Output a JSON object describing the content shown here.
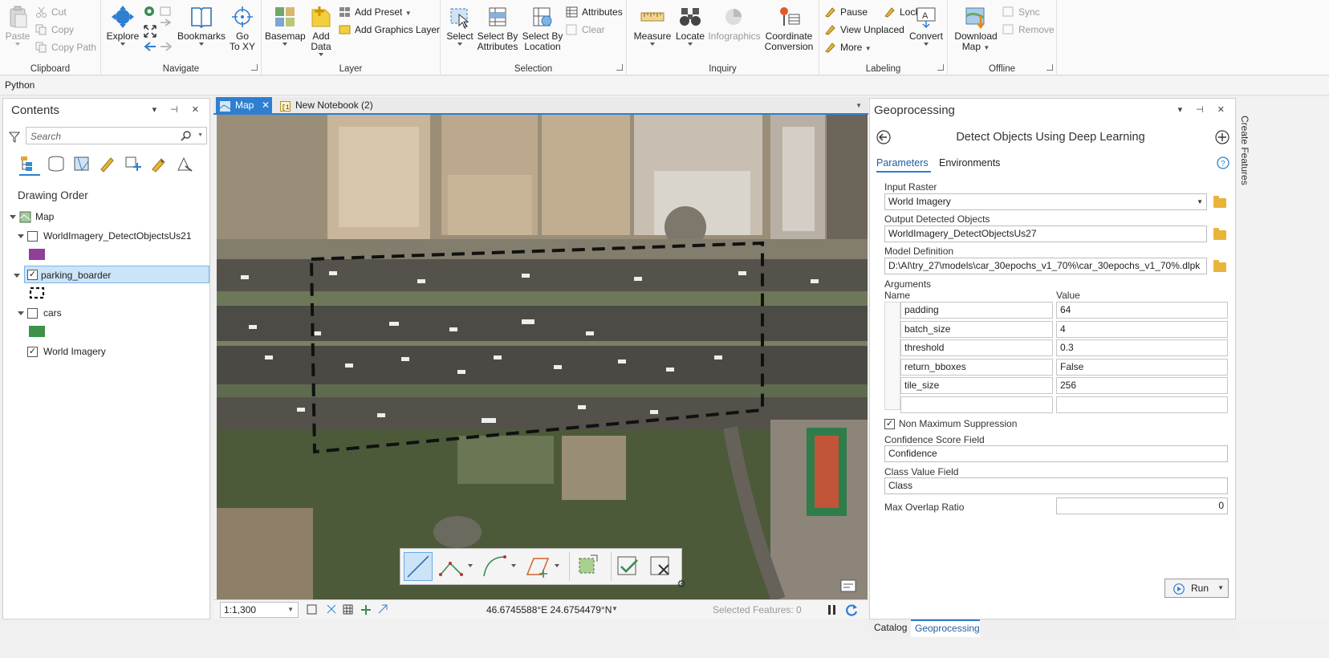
{
  "ribbon": {
    "clipboard": {
      "label": "Clipboard",
      "paste": "Paste",
      "cut": "Cut",
      "copy": "Copy",
      "copy_path": "Copy Path"
    },
    "navigate": {
      "label": "Navigate",
      "explore": "Explore",
      "bookmarks": "Bookmarks",
      "go_to_xy_line1": "Go",
      "go_to_xy_line2": "To XY"
    },
    "layer": {
      "label": "Layer",
      "basemap": "Basemap",
      "add_data_line1": "Add",
      "add_data_line2": "Data",
      "add_preset": "Add Preset",
      "add_graphics_layer": "Add Graphics Layer"
    },
    "selection": {
      "label": "Selection",
      "select": "Select",
      "select_by_attributes_line1": "Select By",
      "select_by_attributes_line2": "Attributes",
      "select_by_location_line1": "Select By",
      "select_by_location_line2": "Location",
      "attributes": "Attributes",
      "clear": "Clear"
    },
    "inquiry": {
      "label": "Inquiry",
      "measure": "Measure",
      "locate": "Locate",
      "infographics": "Infographics",
      "coord_line1": "Coordinate",
      "coord_line2": "Conversion"
    },
    "labeling": {
      "label": "Labeling",
      "pause": "Pause",
      "lock": "Lock",
      "view_unplaced": "View Unplaced",
      "more": "More",
      "convert": "Convert"
    },
    "offline": {
      "label": "Offline",
      "download_map_line1": "Download",
      "download_map_line2": "Map",
      "sync": "Sync",
      "remove": "Remove"
    }
  },
  "python_tab": "Python",
  "contents": {
    "title": "Contents",
    "search_placeholder": "Search",
    "drawing_order": "Drawing Order",
    "layers": [
      {
        "name": "Map"
      },
      {
        "name": "WorldImagery_DetectObjectsUs21",
        "checked": false,
        "swatch": "#8f3f97"
      },
      {
        "name": "parking_boarder",
        "checked": true,
        "selected": true
      },
      {
        "name": "cars",
        "checked": false,
        "swatch": "#3d9148"
      },
      {
        "name": "World Imagery",
        "checked": true
      }
    ]
  },
  "map_tabs": [
    {
      "label": "Map",
      "active": true
    },
    {
      "label": "New Notebook (2)",
      "active": false
    }
  ],
  "statusbar": {
    "scale": "1:1,300",
    "coordinates": "46.6745588°E 24.6754479°N",
    "selected_features": "Selected Features: 0"
  },
  "side_tab": "Create Features",
  "geoprocessing": {
    "title": "Geoprocessing",
    "tool_title": "Detect Objects Using Deep Learning",
    "tabs": [
      "Parameters",
      "Environments"
    ],
    "input_raster_label": "Input Raster",
    "input_raster": "World Imagery",
    "output_label": "Output Detected Objects",
    "output": "WorldImagery_DetectObjectsUs27",
    "model_label": "Model Definition",
    "model": "D:\\AI\\try_27\\models\\car_30epochs_v1_70%\\car_30epochs_v1_70%.dlpk",
    "arguments_label": "Arguments",
    "col_name": "Name",
    "col_value": "Value",
    "arguments": [
      {
        "name": "padding",
        "value": "64"
      },
      {
        "name": "batch_size",
        "value": "4"
      },
      {
        "name": "threshold",
        "value": "0.3"
      },
      {
        "name": "return_bboxes",
        "value": "False"
      },
      {
        "name": "tile_size",
        "value": "256"
      },
      {
        "name": "",
        "value": ""
      }
    ],
    "nms_label": "Non Maximum Suppression",
    "nms_checked": true,
    "confidence_label": "Confidence Score Field",
    "confidence": "Confidence",
    "class_label": "Class Value Field",
    "class": "Class",
    "overlap_label": "Max Overlap Ratio",
    "overlap": "0",
    "run": "Run",
    "bottom_tabs": [
      "Catalog",
      "Geoprocessing"
    ]
  }
}
